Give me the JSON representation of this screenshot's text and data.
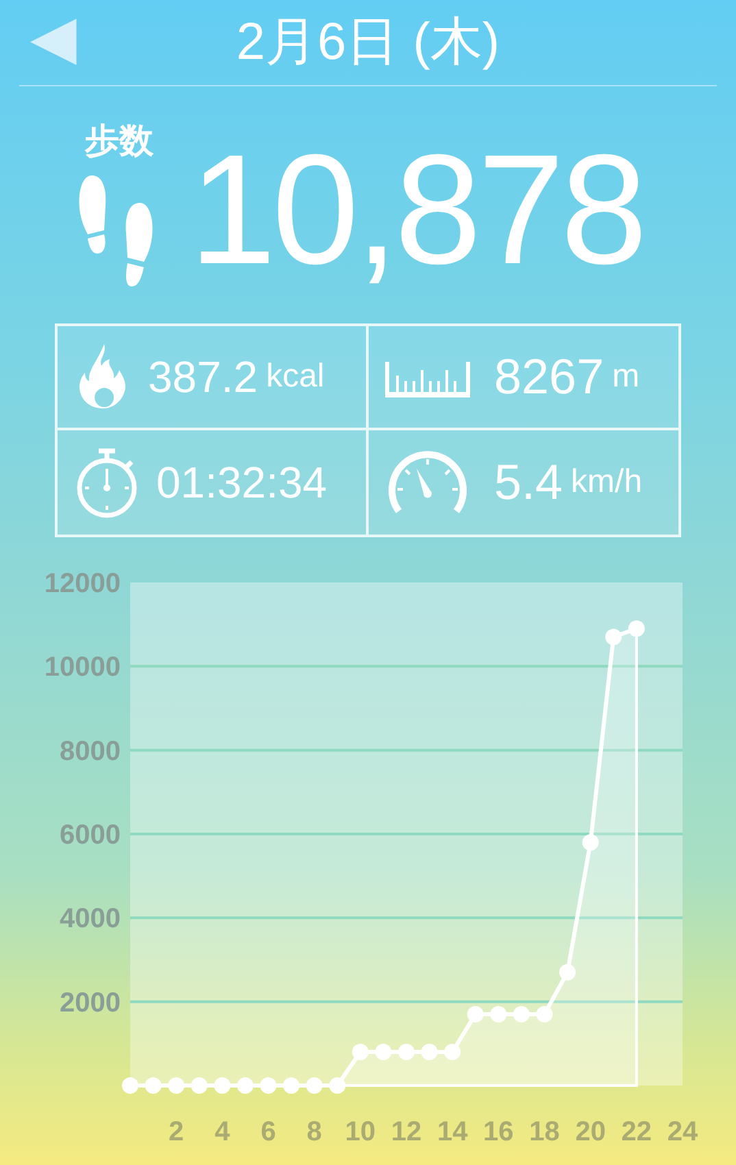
{
  "header": {
    "back": "◀",
    "title": "2月6日 (木)"
  },
  "steps": {
    "label": "歩数",
    "value": "10,878"
  },
  "stats": [
    {
      "kind": "calories",
      "value": "387.2",
      "unit": "kcal"
    },
    {
      "kind": "distance",
      "value": "8267",
      "unit": "m"
    },
    {
      "kind": "time",
      "value": "01:32:34"
    },
    {
      "kind": "speed",
      "value": "5.4",
      "unit": "km/h"
    }
  ],
  "chart": {
    "chart_data": {
      "type": "area",
      "x": [
        0,
        1,
        2,
        3,
        4,
        5,
        6,
        7,
        8,
        9,
        10,
        11,
        12,
        13,
        14,
        15,
        16,
        17,
        18,
        19,
        20,
        21,
        22
      ],
      "xlim": [
        0,
        24
      ],
      "ylim": [
        0,
        12000
      ],
      "xticks": [
        2,
        4,
        6,
        8,
        10,
        12,
        14,
        16,
        18,
        20,
        22,
        24
      ],
      "yticks": [
        2000,
        4000,
        6000,
        8000,
        10000,
        12000
      ],
      "grid": true,
      "series": [
        {
          "color": "#ffffff",
          "values": [
            0,
            0,
            0,
            0,
            0,
            0,
            0,
            0,
            0,
            0,
            800,
            800,
            800,
            800,
            800,
            1700,
            1700,
            1700,
            1700,
            2700,
            5800,
            10700,
            10900
          ]
        }
      ]
    }
  }
}
